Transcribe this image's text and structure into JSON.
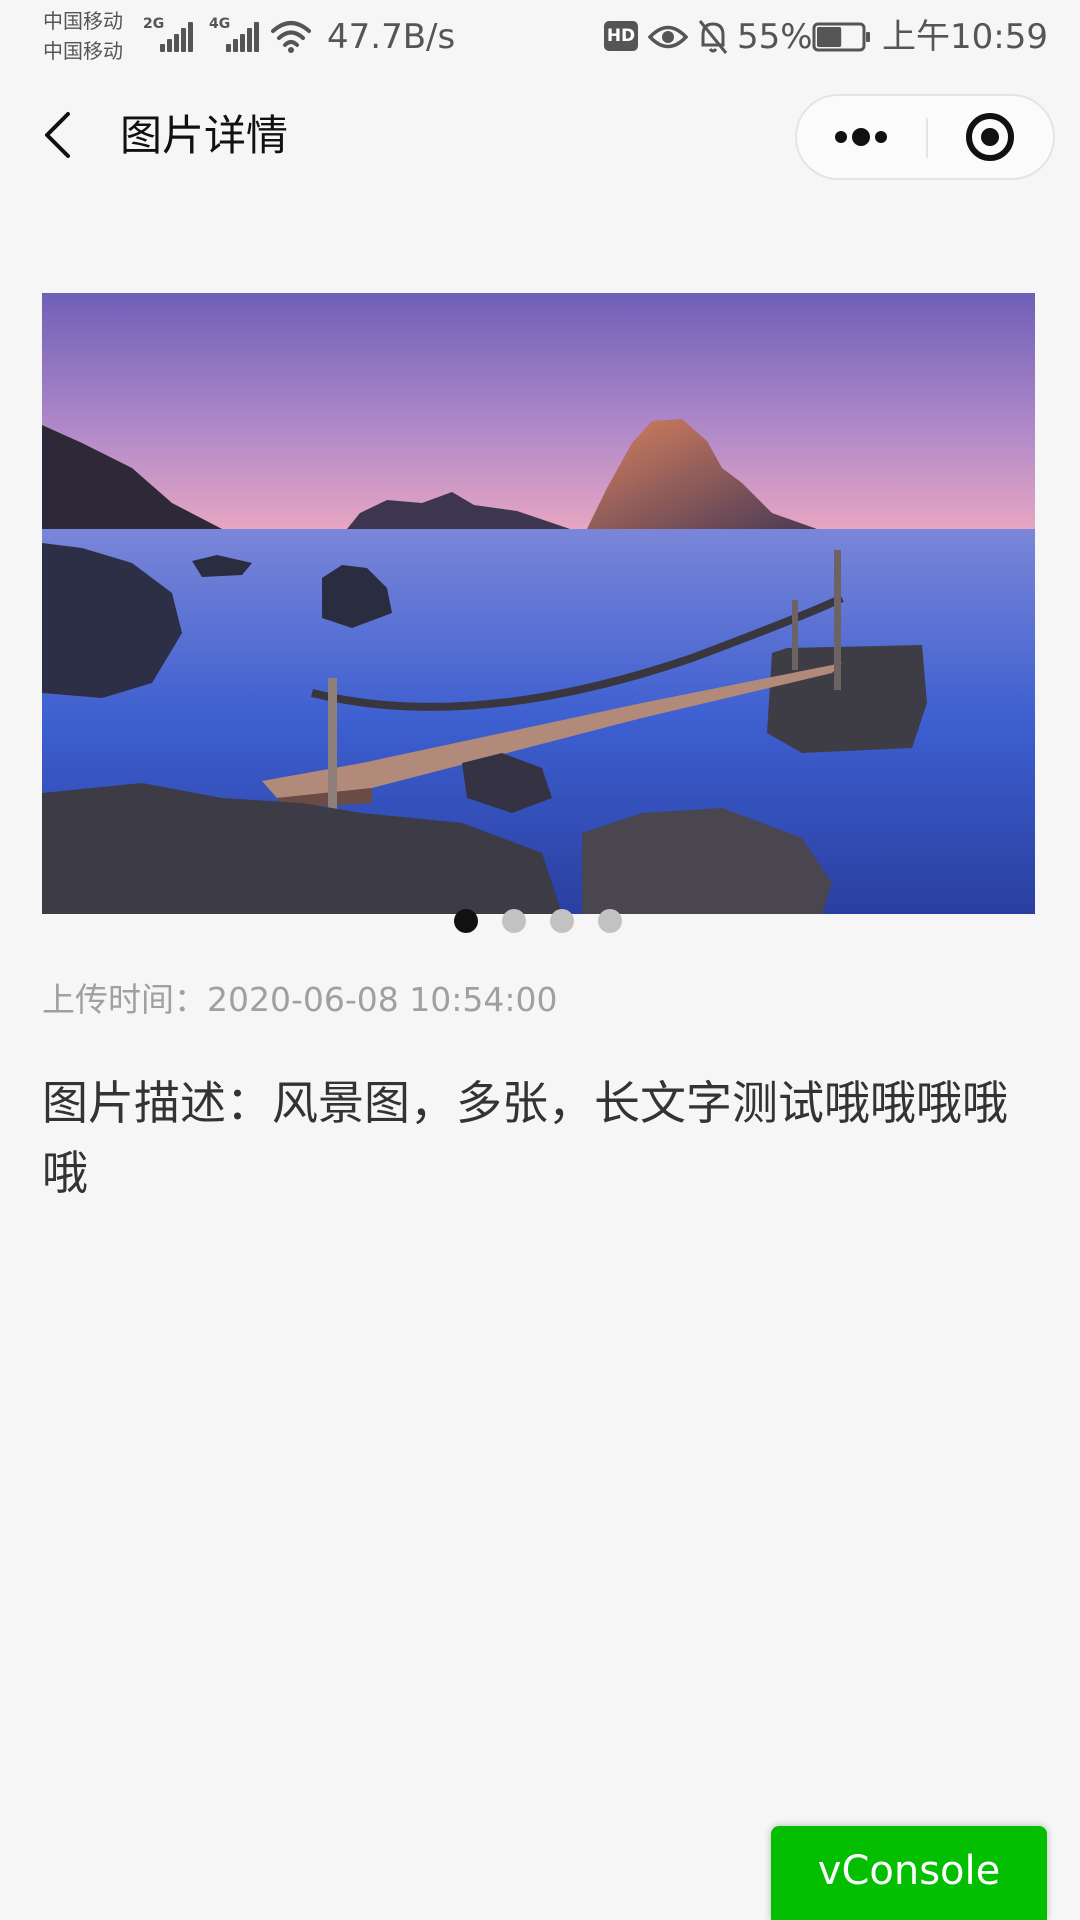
{
  "status_bar": {
    "carrier_1": "中国移动",
    "carrier_2": "中国移动",
    "network_1": "2G",
    "network_2": "4G",
    "net_speed": "47.7B/s",
    "hd_badge": "HD",
    "battery_percent": "55%",
    "battery_level": 0.55,
    "time": "上午10:59"
  },
  "nav": {
    "title": "图片详情",
    "back_icon": "chevron-left-icon",
    "more_icon": "more-dots-icon",
    "close_icon": "target-circle-icon"
  },
  "gallery": {
    "image_count": 4,
    "active_index": 0,
    "image_subject": "seascape-pier-islands"
  },
  "details": {
    "upload_time": "上传时间：2020-06-08 10:54:00",
    "description": "图片描述：风景图，多张，长文字测试哦哦哦哦哦"
  },
  "vconsole": {
    "label": "vConsole",
    "color": "#04be02"
  }
}
